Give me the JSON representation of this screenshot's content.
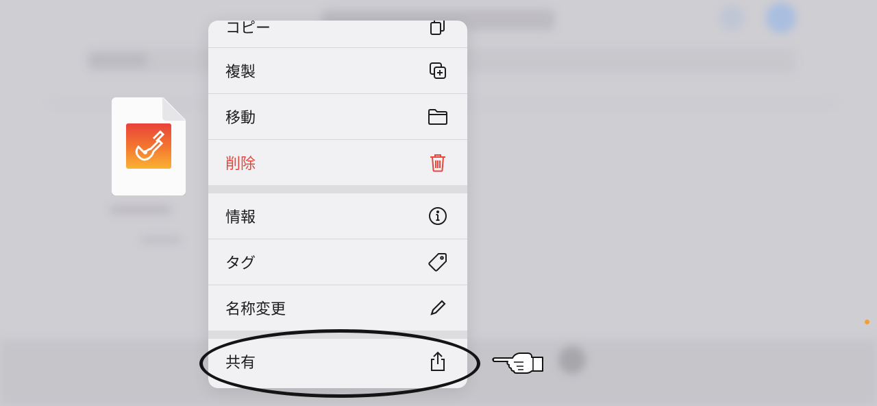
{
  "menu": {
    "items": [
      {
        "label": "コピー",
        "icon": "copy-icon"
      },
      {
        "label": "複製",
        "icon": "duplicate-icon"
      },
      {
        "label": "移動",
        "icon": "folder-icon"
      },
      {
        "label": "削除",
        "icon": "trash-icon",
        "color": "#e8453c"
      },
      {
        "label": "情報",
        "icon": "info-icon"
      },
      {
        "label": "タグ",
        "icon": "tag-icon"
      },
      {
        "label": "名称変更",
        "icon": "pencil-icon"
      },
      {
        "label": "共有",
        "icon": "share-icon"
      }
    ]
  },
  "file": {
    "app_icon": "garageband-guitar-icon"
  },
  "annotation": {
    "highlight": "ellipse-around-share",
    "pointer": "pointing-hand-icon"
  },
  "colors": {
    "destructive": "#e8453c",
    "menu_bg": "#f1f1f3",
    "backdrop": "#cfced3"
  }
}
